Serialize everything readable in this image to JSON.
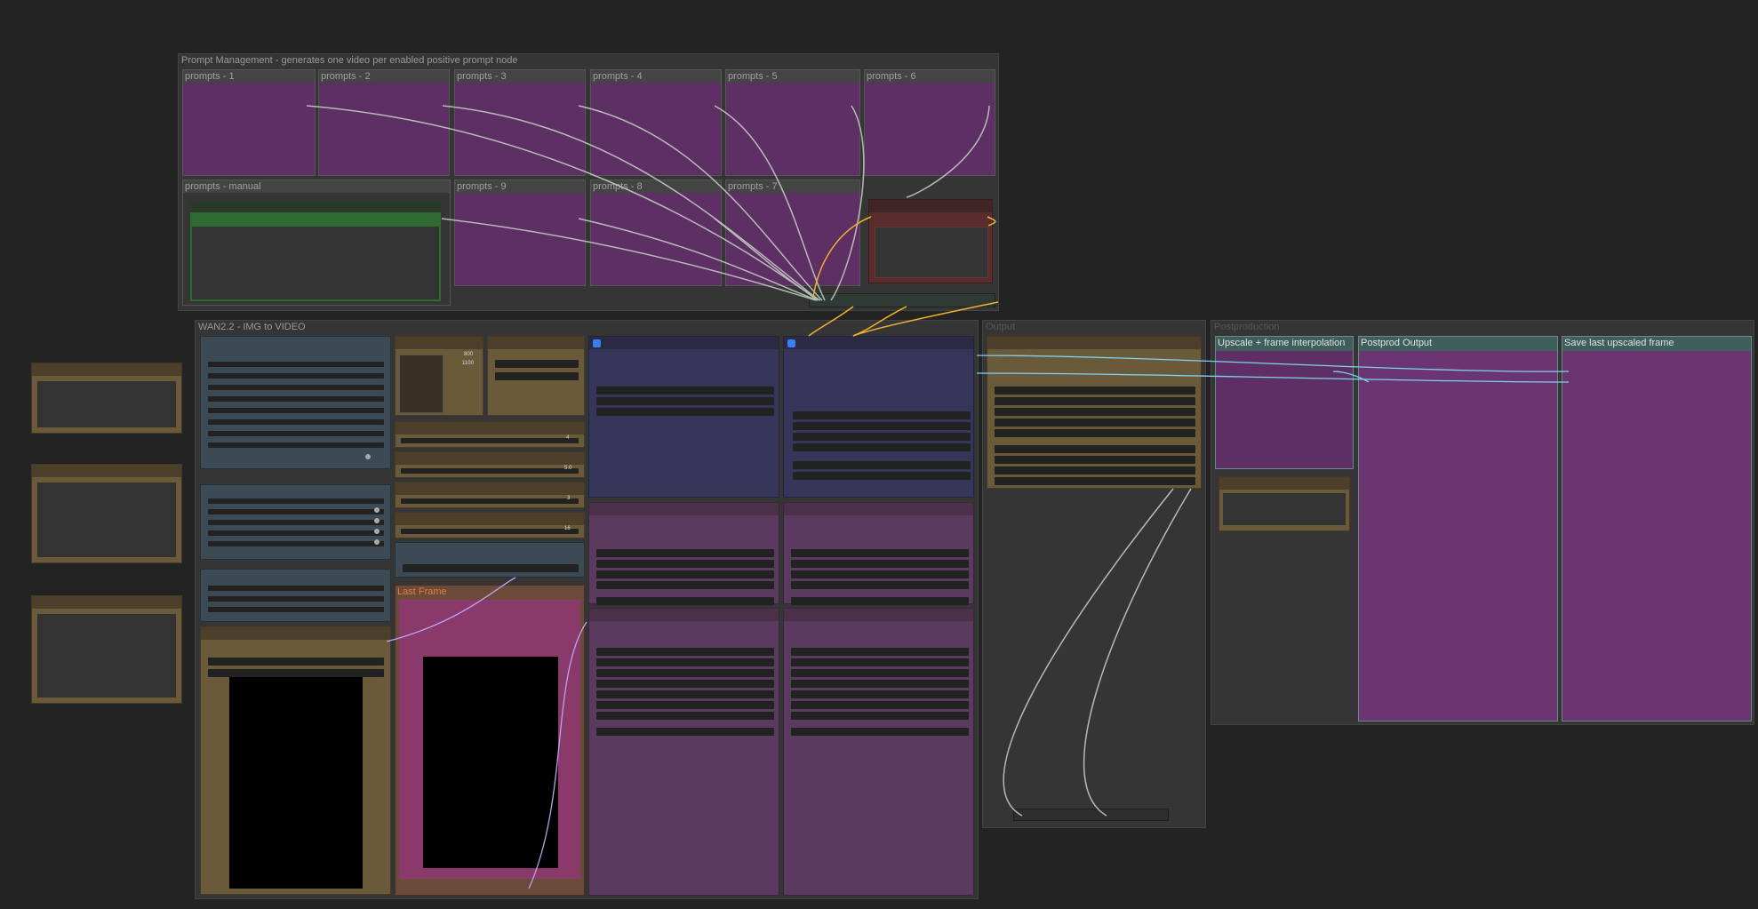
{
  "groups": {
    "prompt_management": "Prompt Management - generates one video per enabled positive prompt node",
    "wan": "WAN2.2 - IMG to VIDEO",
    "output": "Output",
    "postproduction": "Postproduction"
  },
  "prompt_nodes": {
    "p1": "prompts - 1",
    "p2": "prompts - 2",
    "p3": "prompts - 3",
    "p4": "prompts - 4",
    "p5": "prompts - 5",
    "p6": "prompts - 6",
    "manual": "prompts - manual",
    "p9": "prompts - 9",
    "p8": "prompts - 8",
    "p7": "prompts - 7"
  },
  "wan_nodes": {
    "last_frame": "Last Frame",
    "size_w": "800",
    "size_h": "1100",
    "val_a": "4",
    "val_b": "5.0",
    "val_c": "3",
    "val_d": "16"
  },
  "post_nodes": {
    "upscale": "Upscale + frame interpolation",
    "postprod_output": "Postprod Output",
    "save_last": "Save last upscaled frame"
  },
  "colors": {
    "prompt_node": "#5e2f64",
    "loader_node": "#6b5a3a",
    "sampler_node": "#36365a",
    "manual_prompt_header": "#2f6a33",
    "negative_prompt": "#5a2d2d",
    "canvas": "#232323",
    "group": "#353535"
  }
}
